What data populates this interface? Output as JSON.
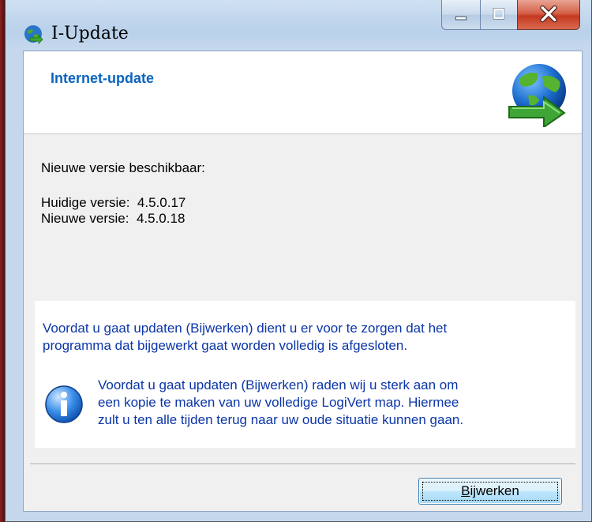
{
  "window": {
    "title": "I-Update",
    "controls": {
      "minimize": "minimize",
      "maximize": "maximize",
      "close": "close"
    }
  },
  "header": {
    "title": "Internet-update"
  },
  "status": {
    "headline": "Nieuwe versie beschikbaar:",
    "current_label": "Huidige versie:",
    "current_version": "4.5.0.17",
    "new_label": "Nieuwe versie:",
    "new_version": "4.5.0.18"
  },
  "notice": {
    "line1": "Voordat u gaat updaten (Bijwerken) dient u er voor te zorgen dat het",
    "line2": "programma dat bijgewerkt gaat worden volledig is afgesloten.",
    "info_line1": "Voordat u gaat updaten (Bijwerken) raden wij u sterk aan om",
    "info_line2": "een kopie te maken van uw volledige LogiVert map. Hiermee",
    "info_line3": "zult u ten alle tijden terug naar uw oude situatie kunnen gaan."
  },
  "actions": {
    "update_label_first": "B",
    "update_label_rest": "ijwerken"
  },
  "colors": {
    "header_title": "#0b64c0",
    "notice_text": "#0b35a8",
    "close_button": "#c4391f"
  }
}
